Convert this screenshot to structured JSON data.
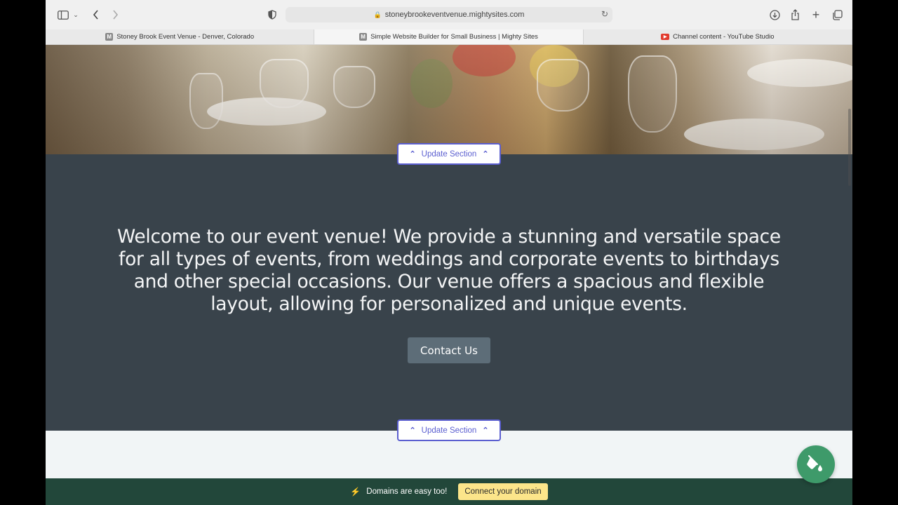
{
  "browser": {
    "url": "stoneybrookeventvenue.mightysites.com",
    "tabs": [
      {
        "favicon": "M",
        "title": "Stoney Brook Event Venue - Denver, Colorado",
        "active": false
      },
      {
        "favicon": "M",
        "title": "Simple Website Builder for Small Business | Mighty Sites",
        "active": true
      },
      {
        "favicon": "youtube-icon",
        "title": "Channel content - YouTube Studio",
        "active": false
      }
    ]
  },
  "editor": {
    "update_section_label": "Update Section"
  },
  "welcome_section": {
    "text": "Welcome to our event venue! We provide a stunning and versatile space for all types of events, from weddings and corporate events to birthdays and other special occasions. Our venue offers a spacious and flexible layout, allowing for personalized and unique events.",
    "button_label": "Contact Us"
  },
  "domain_bar": {
    "text": "Domains are easy too!",
    "button_label": "Connect your domain"
  },
  "colors": {
    "dark_section": "#39434b",
    "contact_button": "#5d6d78",
    "domain_bar": "#22473a",
    "domain_button": "#fce58a",
    "accent": "#5b5fd0",
    "fab": "#3e9a6a"
  }
}
